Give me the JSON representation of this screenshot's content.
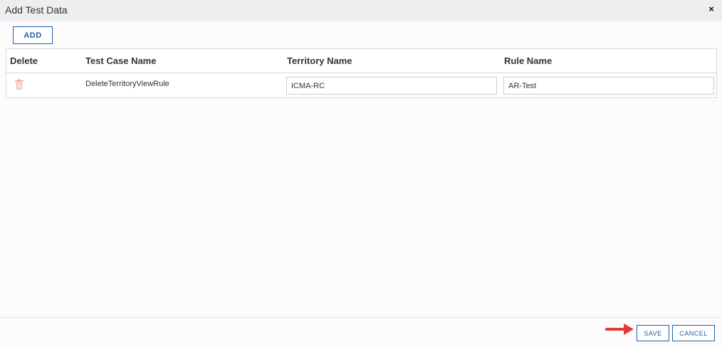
{
  "dialog": {
    "title": "Add Test Data",
    "close_symbol": "×"
  },
  "toolbar": {
    "add_label": "ADD"
  },
  "grid": {
    "columns": [
      "Delete",
      "Test Case Name",
      "Territory Name",
      "Rule Name"
    ],
    "rows": [
      {
        "delete_icon": "trash-icon",
        "test_case_name": "DeleteTerritoryViewRule",
        "territory_name": "ICMA-RC",
        "rule_name": "AR-Test"
      }
    ]
  },
  "footer": {
    "save_label": "SAVE",
    "cancel_label": "CANCEL"
  },
  "colors": {
    "accent": "#1f5fa8",
    "trash": "#f5a3a3",
    "annotation_arrow": "#e53935"
  }
}
